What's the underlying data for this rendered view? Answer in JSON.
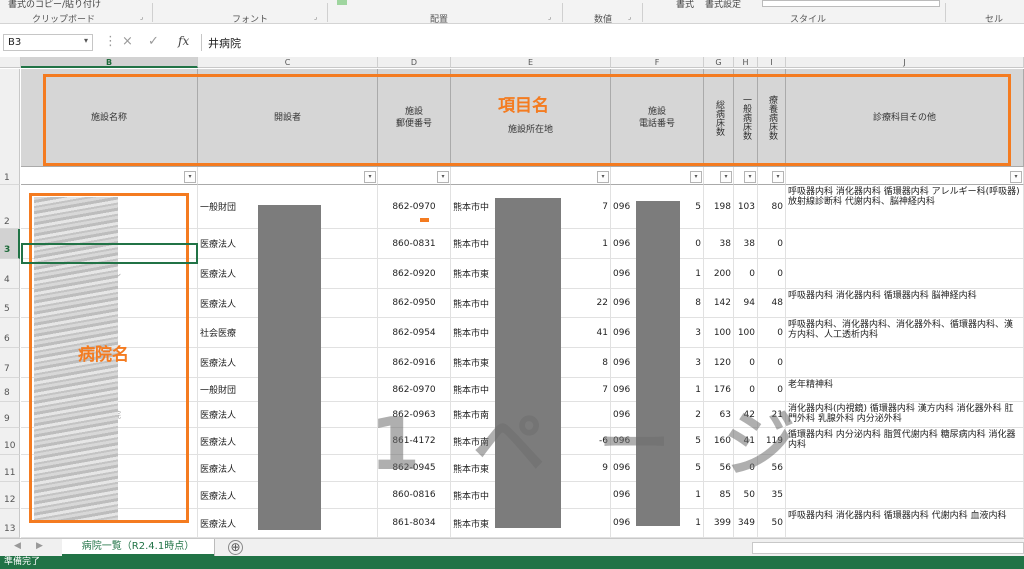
{
  "ribbon": {
    "top_items": [
      "書式のコピー/貼り付け",
      "書式",
      "書式設定"
    ],
    "groups": [
      "クリップボード",
      "フォント",
      "配置",
      "数値",
      "スタイル",
      "セル"
    ]
  },
  "formula_bar": {
    "name_box": "B3",
    "fx": "fx",
    "value": "井病院",
    "cancel_icon": "×",
    "enter_icon": "✓"
  },
  "columns": [
    "B",
    "C",
    "D",
    "E",
    "F",
    "G",
    "H",
    "I",
    "J"
  ],
  "selected_column": "B",
  "rows": [
    "1",
    "2",
    "3",
    "4",
    "5",
    "6",
    "7",
    "8",
    "9",
    "10",
    "11",
    "12",
    "13"
  ],
  "selected_row": "3",
  "headers": {
    "facility_name": "施設名称",
    "founder": "開設者",
    "postal": "施設\n郵便番号",
    "address": "施設所在地",
    "phone": "施設\n電話番号",
    "total_beds": "総病床数",
    "general_beds": "一般病床数",
    "care_beds": "療養病床数",
    "departments": "診療科目その他"
  },
  "filter_icon": "▾",
  "data_rows": [
    {
      "name": "",
      "founder": "一般財団",
      "postal": "862-0970",
      "addr": "熊本市中",
      "addr_tail": "7",
      "phone": "096",
      "phone_tail": "5",
      "total": "198",
      "general": "103",
      "care": "80",
      "dept": "呼吸器内科 消化器内科 循環器内科 アレルギー科(呼吸器) 放射線診断科 代謝内科、脳神経内科"
    },
    {
      "name": "",
      "founder": "医療法人",
      "postal": "860-0831",
      "addr": "熊本市中",
      "addr_tail": "1",
      "phone": "096",
      "phone_tail": "0",
      "total": "38",
      "general": "38",
      "care": "0",
      "dept": ""
    },
    {
      "name": "ビル",
      "founder": "医療法人",
      "postal": "862-0920",
      "addr": "熊本市東",
      "addr_tail": "",
      "phone": "096",
      "phone_tail": "1",
      "total": "200",
      "general": "0",
      "care": "0",
      "dept": ""
    },
    {
      "name": "",
      "founder": "医療法人",
      "postal": "862-0950",
      "addr": "熊本市中",
      "addr_tail": "22",
      "phone": "096",
      "phone_tail": "8",
      "total": "142",
      "general": "94",
      "care": "48",
      "dept": "呼吸器内科 消化器内科 循環器内科 脳神経内科"
    },
    {
      "name": "",
      "founder": "社会医療",
      "postal": "862-0954",
      "addr": "熊本市中",
      "addr_tail": "41",
      "phone": "096",
      "phone_tail": "3",
      "total": "100",
      "general": "100",
      "care": "0",
      "dept": "呼吸器内科、消化器内科、消化器外科、循環器内科、漢方内科、人工透析内科"
    },
    {
      "name": "",
      "founder": "医療法人",
      "postal": "862-0916",
      "addr": "熊本市東",
      "addr_tail": "8",
      "phone": "096",
      "phone_tail": "3",
      "total": "120",
      "general": "0",
      "care": "0",
      "dept": ""
    },
    {
      "name": "",
      "founder": "一般財団",
      "postal": "862-0970",
      "addr": "熊本市中",
      "addr_tail": "7",
      "phone": "096",
      "phone_tail": "1",
      "total": "176",
      "general": "0",
      "care": "0",
      "dept": "老年精神科"
    },
    {
      "name": "病院",
      "founder": "医療法人",
      "postal": "862-0963",
      "addr": "熊本市南",
      "addr_tail": "",
      "phone": "096",
      "phone_tail": "2",
      "total": "63",
      "general": "42",
      "care": "21",
      "dept": "消化器内科(内視鏡) 循環器内科 漢方内科 消化器外科 肛門外科 乳腺外科 内分泌外科"
    },
    {
      "name": "",
      "founder": "医療法人",
      "postal": "861-4172",
      "addr": "熊本市南",
      "addr_tail": "-6",
      "phone": "096",
      "phone_tail": "5",
      "total": "160",
      "general": "41",
      "care": "119",
      "dept": "循環器内科 内分泌内科 脂質代謝内科 糖尿病内科 消化器内科"
    },
    {
      "name": "",
      "founder": "医療法人",
      "postal": "862-0945",
      "addr": "熊本市東",
      "addr_tail": "9",
      "phone": "096",
      "phone_tail": "5",
      "total": "56",
      "general": "0",
      "care": "56",
      "dept": ""
    },
    {
      "name": "",
      "founder": "医療法人",
      "postal": "860-0816",
      "addr": "熊本市中",
      "addr_tail": "",
      "phone": "096",
      "phone_tail": "1",
      "total": "85",
      "general": "50",
      "care": "35",
      "dept": ""
    },
    {
      "name": "",
      "founder": "医療法人",
      "postal": "861-8034",
      "addr": "熊本市東",
      "addr_tail": "",
      "phone": "096",
      "phone_tail": "1",
      "total": "399",
      "general": "349",
      "care": "50",
      "dept": "呼吸器内科 消化器内科 循環器内科 代謝内科 血液内科"
    }
  ],
  "annotations": {
    "header_label": "項目名",
    "name_label": "病院名",
    "accent": "#f47b20"
  },
  "watermark": "1 ペ ー ジ",
  "sheet_tab": "病院一覧（R2.4.1時点）",
  "add_sheet": "⊕",
  "status": "準備完了",
  "colors": {
    "excel_green": "#217346",
    "header_fill": "#d6d6d6",
    "redaction": "#7c7c7c"
  }
}
